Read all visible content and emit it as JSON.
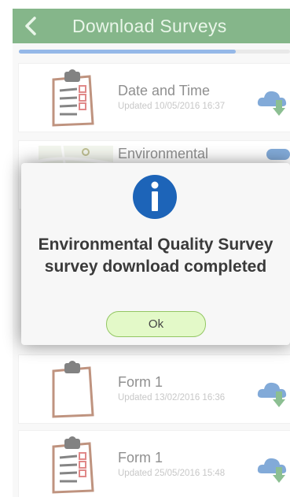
{
  "header": {
    "title": "Download Surveys"
  },
  "progress": {
    "value": 0.8
  },
  "colors": {
    "header_bg": "#227a2a",
    "progress": "#3e7fd6",
    "ok_bg": "#e3f9c8",
    "info": "#1d64b8"
  },
  "surveys": [
    {
      "title": "Date and Time",
      "updated": "Updated 10/05/2016 16:37",
      "icon": "clipboard-checklist-icon"
    },
    {
      "title": "Environmental",
      "updated": "",
      "icon": "map-thumbnail-icon"
    },
    {
      "title": "Form 1",
      "updated": "Updated 13/02/2016 16:36",
      "icon": "clipboard-empty-icon"
    },
    {
      "title": "Form 1",
      "updated": "Updated 25/05/2016 15:48",
      "icon": "clipboard-checklist-icon"
    }
  ],
  "dialog": {
    "icon": "info-icon",
    "line1": "Environmental Quality Survey",
    "line2": "survey download completed",
    "ok_label": "Ok"
  }
}
